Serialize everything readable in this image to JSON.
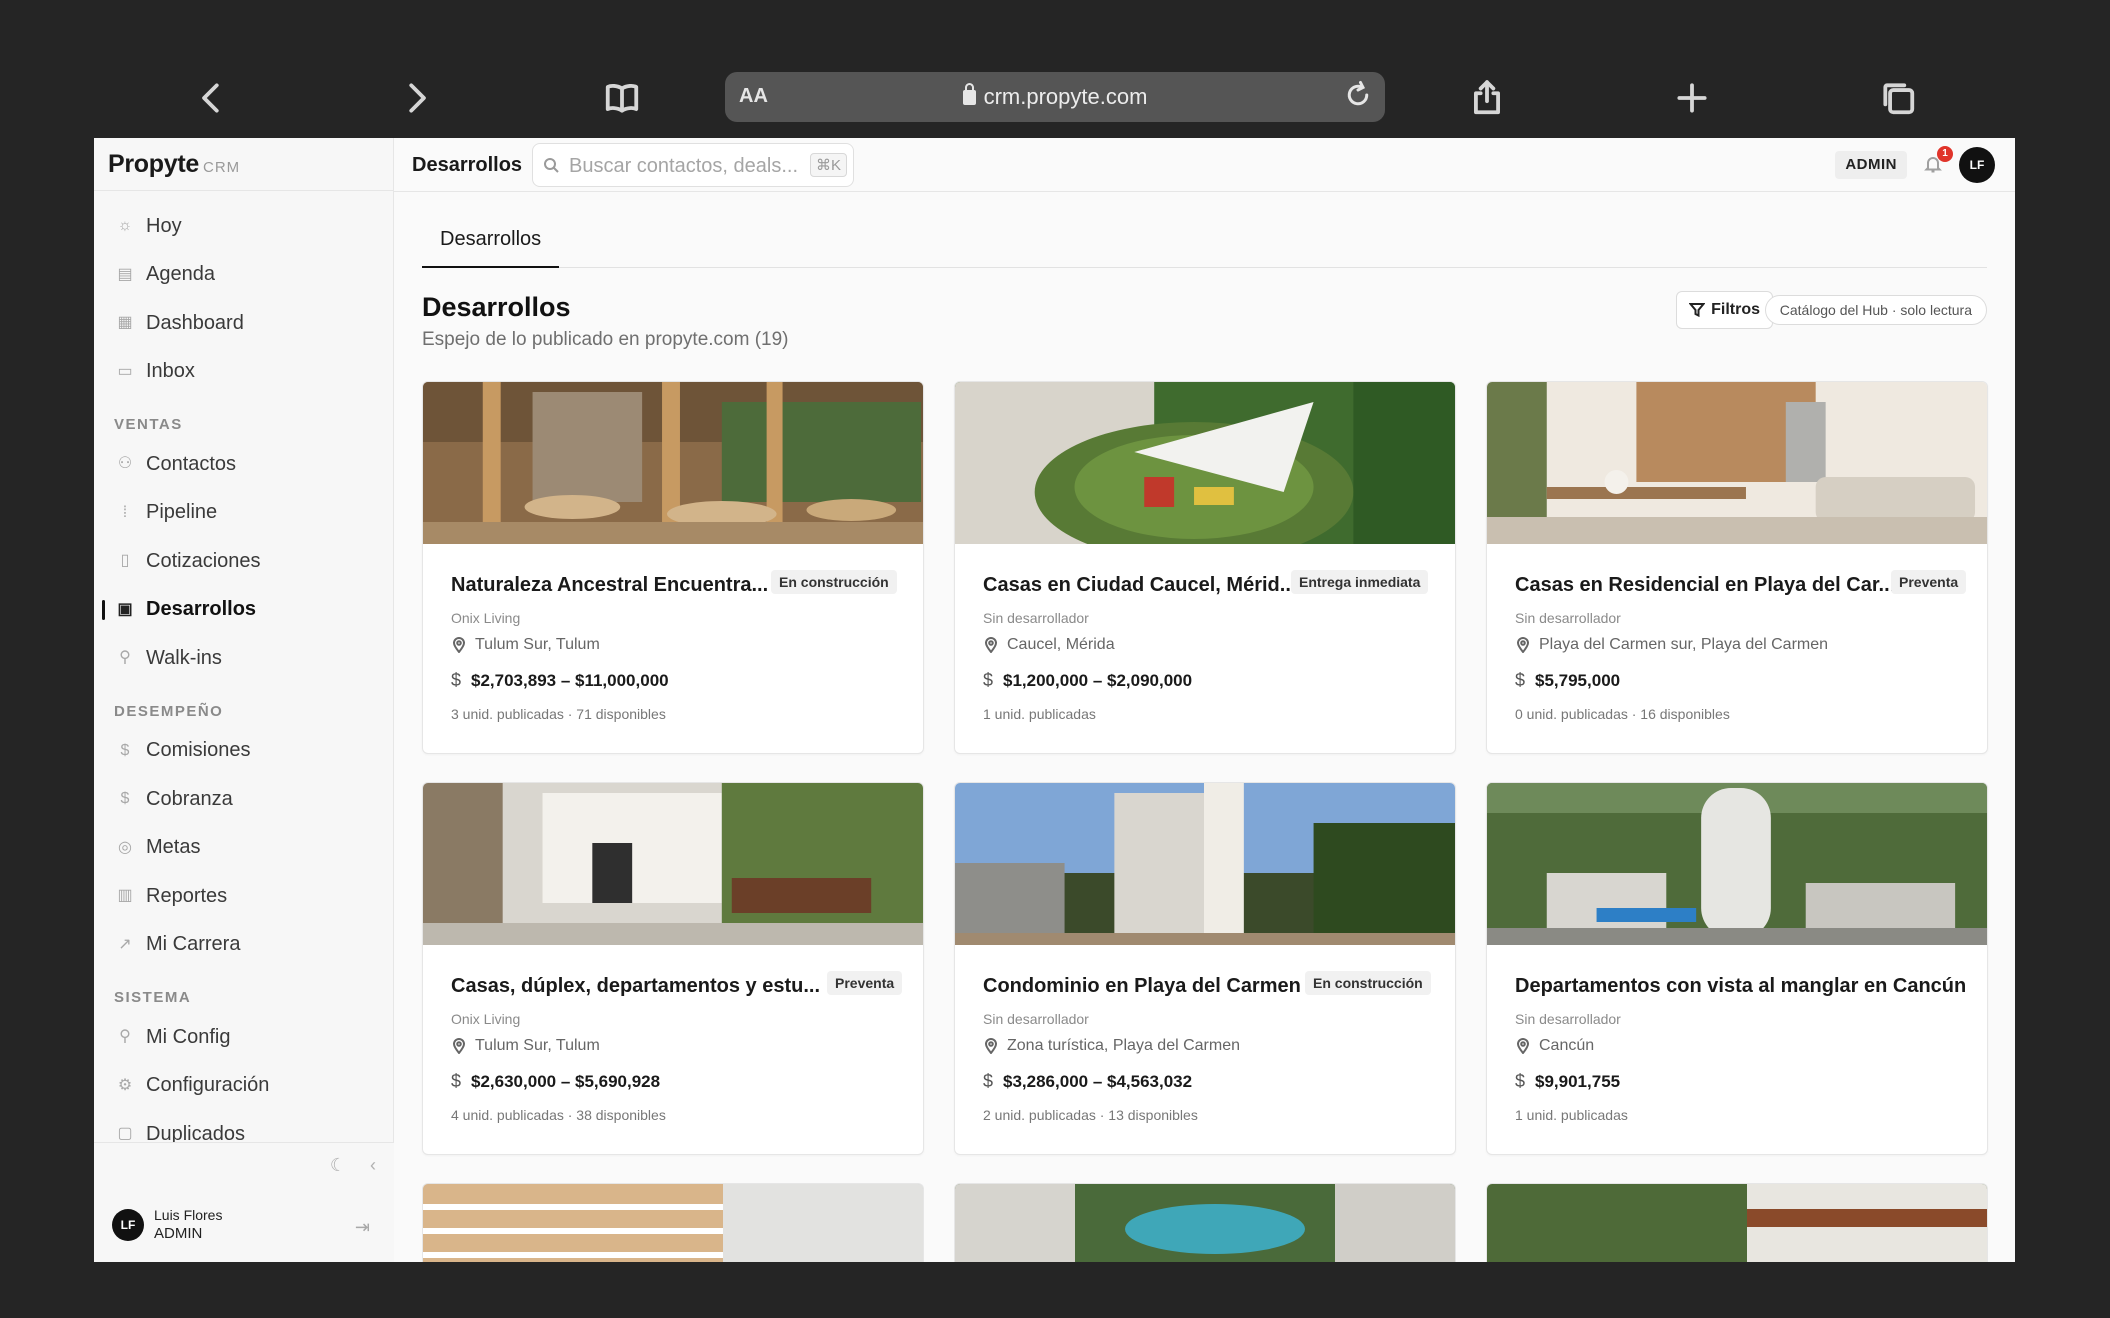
{
  "browser": {
    "text_size_label": "AA",
    "url": "crm.propyte.com"
  },
  "brand": {
    "name": "Propyte",
    "suffix": "CRM"
  },
  "topbar": {
    "title": "Desarrollos",
    "search_placeholder": "Buscar contactos, deals...",
    "search_shortcut": "⌘K",
    "role_badge": "ADMIN",
    "notification_count": "1",
    "avatar_initials": "LF"
  },
  "sidebar": {
    "items_top": [
      {
        "label": "Hoy",
        "icon": "sun-icon"
      },
      {
        "label": "Agenda",
        "icon": "calendar-icon"
      },
      {
        "label": "Dashboard",
        "icon": "grid-icon"
      },
      {
        "label": "Inbox",
        "icon": "chat-icon"
      }
    ],
    "section_ventas": "VENTAS",
    "items_ventas": [
      {
        "label": "Contactos",
        "icon": "users-icon"
      },
      {
        "label": "Pipeline",
        "icon": "pipeline-icon"
      },
      {
        "label": "Cotizaciones",
        "icon": "document-icon"
      },
      {
        "label": "Desarrollos",
        "icon": "building-icon",
        "active": true
      },
      {
        "label": "Walk-ins",
        "icon": "user-plus-icon"
      }
    ],
    "section_desempeno": "DESEMPEÑO",
    "items_desempeno": [
      {
        "label": "Comisiones",
        "icon": "dollar-icon"
      },
      {
        "label": "Cobranza",
        "icon": "dollar-icon"
      },
      {
        "label": "Metas",
        "icon": "target-icon"
      },
      {
        "label": "Reportes",
        "icon": "bar-chart-icon"
      },
      {
        "label": "Mi Carrera",
        "icon": "trend-icon"
      }
    ],
    "section_sistema": "SISTEMA",
    "items_sistema": [
      {
        "label": "Mi Config",
        "icon": "user-icon"
      },
      {
        "label": "Configuración",
        "icon": "gear-icon"
      },
      {
        "label": "Duplicados",
        "icon": "copy-icon"
      }
    ],
    "footer": {
      "user_name": "Luis Flores",
      "user_role": "ADMIN",
      "avatar_initials": "LF"
    }
  },
  "main": {
    "tab": "Desarrollos",
    "title": "Desarrollos",
    "subtitle": "Espejo de lo publicado en propyte.com (19)",
    "filters_label": "Filtros",
    "catalog_label": "Catálogo del Hub · solo lectura",
    "cards": [
      {
        "title": "Naturaleza Ancestral Encuentra...",
        "badge": "En construcción",
        "developer": "Onix Living",
        "location": "Tulum Sur, Tulum",
        "price": "$2,703,893 – $11,000,000",
        "units": "3 unid. publicadas · 71 disponibles"
      },
      {
        "title": "Casas en Ciudad Caucel, Mérid...",
        "badge": "Entrega inmediata",
        "developer": "Sin desarrollador",
        "location": "Caucel, Mérida",
        "price": "$1,200,000 – $2,090,000",
        "units": "1 unid. publicadas"
      },
      {
        "title": "Casas en Residencial en Playa del Car...",
        "badge": "Preventa",
        "developer": "Sin desarrollador",
        "location": "Playa del Carmen sur, Playa del Carmen",
        "price": "$5,795,000",
        "units": "0 unid. publicadas · 16 disponibles"
      },
      {
        "title": "Casas, dúplex, departamentos y estu...",
        "badge": "Preventa",
        "developer": "Onix Living",
        "location": "Tulum Sur, Tulum",
        "price": "$2,630,000 – $5,690,928",
        "units": "4 unid. publicadas · 38 disponibles"
      },
      {
        "title": "Condominio en Playa del Carmen",
        "badge": "En construcción",
        "developer": "Sin desarrollador",
        "location": "Zona turística, Playa del Carmen",
        "price": "$3,286,000 – $4,563,032",
        "units": "2 unid. publicadas · 13 disponibles"
      },
      {
        "title": "Departamentos con vista al manglar en Cancún",
        "badge": "",
        "developer": "Sin desarrollador",
        "location": "Cancún",
        "price": "$9,901,755",
        "units": "1 unid. publicadas"
      }
    ]
  }
}
